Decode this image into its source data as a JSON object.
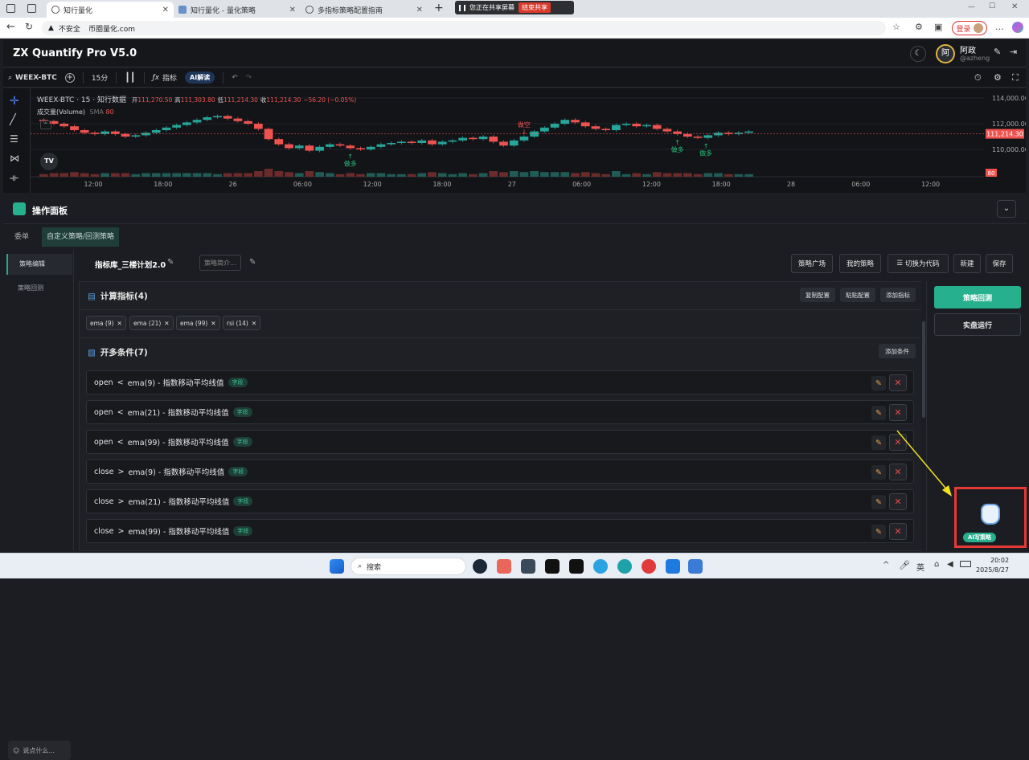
{
  "browser": {
    "tabs": [
      {
        "label": "知行量化",
        "active": true
      },
      {
        "label": "知行量化 - 量化策略",
        "active": false
      },
      {
        "label": "多指标策略配置指南",
        "active": false
      }
    ],
    "share_text": "您正在共享屏幕",
    "share_stop": "结束共享",
    "insecure_label": "不安全",
    "url": "币圈量化.com",
    "login_label": "登录"
  },
  "app": {
    "title": "ZX Quantify Pro V5.0",
    "user_avatar_letter": "阿",
    "user_name": "阿政",
    "user_handle": "@azheng"
  },
  "toolbar": {
    "symbol": "WEEX-BTC",
    "interval": "15分",
    "indicators_label": "指标",
    "ai_label": "AI解读"
  },
  "chart_data": {
    "type": "candlestick",
    "title": "WEEX-BTC · 15 · 知行数据",
    "ohlc": {
      "open_label": "开",
      "open": "111,270.50",
      "high_label": "高",
      "high": "111,303.80",
      "low_label": "低",
      "low": "111,214.30",
      "close_label": "收",
      "close": "111,214.30",
      "change": "−56.20 (−0.05%)"
    },
    "volume_label": "成交量(Volume)",
    "sma_label": "SMA",
    "sma_value": "80",
    "current_price": "111,214.30",
    "volume_badge": "80",
    "y_ticks": [
      "114,000.00",
      "112,000.00",
      "110,000.00"
    ],
    "ylim": [
      108500,
      114500
    ],
    "x_ticks": [
      "12:00",
      "18:00",
      "26",
      "06:00",
      "12:00",
      "18:00",
      "27",
      "06:00",
      "12:00",
      "18:00",
      "28",
      "06:00",
      "12:00"
    ],
    "close_series": [
      112200,
      112000,
      111800,
      111500,
      111300,
      111200,
      111400,
      111200,
      111000,
      111100,
      111300,
      111500,
      111700,
      111900,
      112100,
      112300,
      112500,
      112600,
      112400,
      112200,
      112000,
      111600,
      110800,
      110400,
      110100,
      110300,
      109900,
      110200,
      110400,
      110300,
      110100,
      110000,
      110200,
      110400,
      110500,
      110600,
      110500,
      110700,
      110400,
      110600,
      110700,
      110900,
      110800,
      111000,
      110600,
      110300,
      110700,
      111000,
      111400,
      111700,
      112000,
      112300,
      112100,
      111800,
      111600,
      111500,
      111900,
      112000,
      111800,
      111900,
      111600,
      111400,
      111200,
      111000,
      110900,
      111100,
      111300,
      111200,
      111300,
      111400
    ],
    "annotations": [
      {
        "text": "做多",
        "kind": "long"
      },
      {
        "text": "做空",
        "kind": "short"
      },
      {
        "text": "做多",
        "kind": "long"
      },
      {
        "text": "做多",
        "kind": "long"
      }
    ]
  },
  "panel": {
    "title": "操作面板",
    "tabs": [
      "委单",
      "自定义策略/回测策略"
    ],
    "left_nav": [
      "策略编辑",
      "策略回测"
    ],
    "chat_placeholder": "说点什么..."
  },
  "strategy": {
    "name": "指标库_三楼计划2.0",
    "desc_placeholder": "策略简介...",
    "buttons": [
      "策略广场",
      "我的策略",
      "切换为代码",
      "新建",
      "保存"
    ]
  },
  "indicators": {
    "title": "计算指标(4)",
    "buttons": [
      "复制配置",
      "粘贴配置",
      "添加指标"
    ],
    "chips": [
      "ema (9)",
      "ema (21)",
      "ema (99)",
      "rsi (14)"
    ]
  },
  "conditions": {
    "title": "开多条件(7)",
    "add_label": "添加条件",
    "tag": "字段",
    "items": [
      {
        "field": "open",
        "op": "<",
        "target": "ema(9) - 指数移动平均线值"
      },
      {
        "field": "open",
        "op": "<",
        "target": "ema(21) - 指数移动平均线值"
      },
      {
        "field": "open",
        "op": "<",
        "target": "ema(99) - 指数移动平均线值"
      },
      {
        "field": "close",
        "op": ">",
        "target": "ema(9) - 指数移动平均线值"
      },
      {
        "field": "close",
        "op": ">",
        "target": "ema(21) - 指数移动平均线值"
      },
      {
        "field": "close",
        "op": ">",
        "target": "ema(99) - 指数移动平均线值"
      }
    ]
  },
  "actions": {
    "backtest": "策略回测",
    "live": "实盘运行",
    "ai_strategy": "AI写策略"
  },
  "taskbar": {
    "search": "搜索",
    "lang": "英",
    "time": "20:02",
    "date": "2025/8/27"
  },
  "colors": {
    "accent": "#26b08e",
    "up": "#26a69a",
    "down": "#ef5350",
    "highlight": "#e53935"
  }
}
